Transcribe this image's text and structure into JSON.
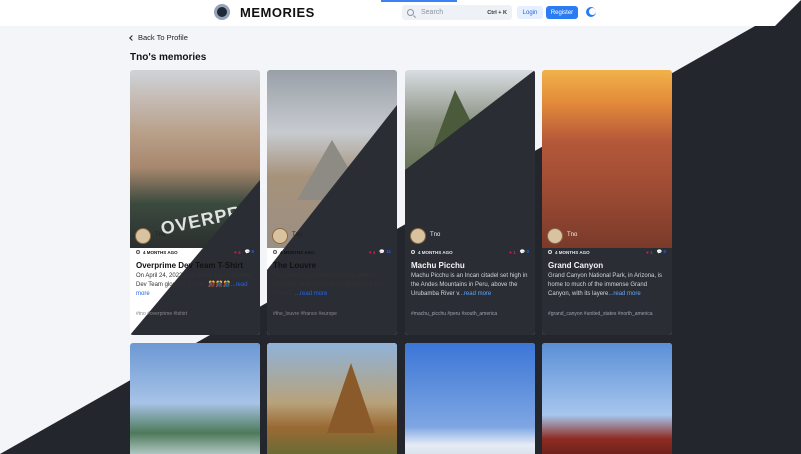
{
  "app": {
    "name": "MEMORIES"
  },
  "search": {
    "placeholder": "Search",
    "shortcut": "Ctrl + K"
  },
  "auth": {
    "login": "Login",
    "register": "Register"
  },
  "nav": {
    "back_label": "Back To Profile"
  },
  "page": {
    "title": "Tno's memories"
  },
  "cards": [
    {
      "author": "Tno",
      "time": "4 MONTHS AGO",
      "likes": "4",
      "comments": "5",
      "title": "Overprime Dev Team T-Shirt",
      "description": "On April 24, 2022, I received the Overprime Dev Team glorious T-Shirt! 🎊🎊🎊",
      "read_more": "...read more",
      "tags": "#tno #overprime #tshirt",
      "image_text": "OVERPRIM"
    },
    {
      "author": "Tno",
      "time": "4 MONTHS AGO",
      "likes": "4",
      "comments": "11",
      "title": "The Louvre",
      "description": "The Louvre, is the world's most-visited museum, and a historic landmark in Paris, France.",
      "read_more": "...read more",
      "tags": "#the_louvre #france #europe"
    },
    {
      "author": "Tno",
      "time": "4 MONTHS AGO",
      "likes": "1",
      "comments": "0",
      "title": "Machu Picchu",
      "description": "Machu Picchu is an Incan citadel set high in the Andes Mountains in Peru, above the Urubamba River v",
      "read_more": "...read more",
      "tags": "#machu_picchu #peru #south_america"
    },
    {
      "author": "Tno",
      "time": "4 MONTHS AGO",
      "likes": "1",
      "comments": "0",
      "title": "Grand Canyon",
      "description": "Grand Canyon National Park, in Arizona, is home to much of the immense Grand Canyon, with its layere",
      "read_more": "...read more",
      "tags": "#grand_canyon #united_states #north_america"
    }
  ]
}
